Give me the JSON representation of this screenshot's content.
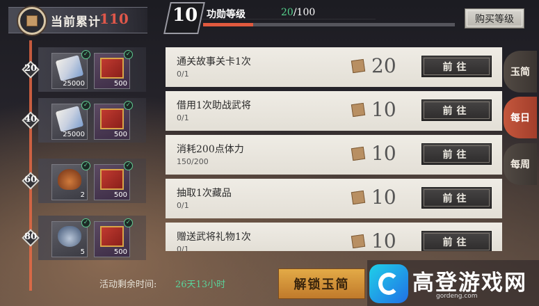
{
  "header": {
    "total_label": "当前累计",
    "total_value": "110",
    "level_number": "10",
    "level_title": "功勋等级",
    "level_current": "20",
    "level_max": "/100",
    "level_progress_fraction": 0.2,
    "buy_level_label": "购买等级"
  },
  "milestones": [
    {
      "level": "20",
      "rewards": [
        {
          "icon": "scroll-icon",
          "amount": "25000",
          "claimed": true
        },
        {
          "icon": "treasure-chest-icon",
          "amount": "500",
          "claimed": true
        }
      ]
    },
    {
      "level": "40",
      "rewards": [
        {
          "icon": "scroll-icon",
          "amount": "25000",
          "claimed": true
        },
        {
          "icon": "treasure-chest-icon",
          "amount": "500",
          "claimed": true
        }
      ]
    },
    {
      "level": "60",
      "rewards": [
        {
          "icon": "food-icon",
          "amount": "2",
          "claimed": true
        },
        {
          "icon": "treasure-chest-icon",
          "amount": "500",
          "claimed": true
        }
      ]
    },
    {
      "level": "80",
      "rewards": [
        {
          "icon": "pouch-icon",
          "amount": "5",
          "claimed": true
        },
        {
          "icon": "treasure-chest-icon",
          "amount": "500",
          "claimed": true
        }
      ]
    }
  ],
  "tasks": [
    {
      "title": "通关故事关卡1次",
      "progress": "0/1",
      "points": "20",
      "action": "前往"
    },
    {
      "title": "借用1次助战武将",
      "progress": "0/1",
      "points": "10",
      "action": "前往"
    },
    {
      "title": "消耗200点体力",
      "progress": "150/200",
      "points": "10",
      "action": "前往"
    },
    {
      "title": "抽取1次藏品",
      "progress": "0/1",
      "points": "10",
      "action": "前往"
    },
    {
      "title": "赠送武将礼物1次",
      "progress": "0/1",
      "points": "10",
      "action": "前往"
    }
  ],
  "tabs": [
    {
      "label": "玉简",
      "active": false
    },
    {
      "label": "每日",
      "active": true
    },
    {
      "label": "每周",
      "active": false
    }
  ],
  "footer": {
    "time_label": "活动剩余时间:",
    "time_value": "26天13小时",
    "unlock_label": "解锁玉简"
  },
  "watermark": {
    "text": "高登游戏网",
    "url": "gordeng.com"
  },
  "colors": {
    "accent_red": "#e0574a",
    "progress_green": "#56d28d",
    "active_tab": "#c4573d",
    "unlock_gold": "#e3aa47"
  }
}
